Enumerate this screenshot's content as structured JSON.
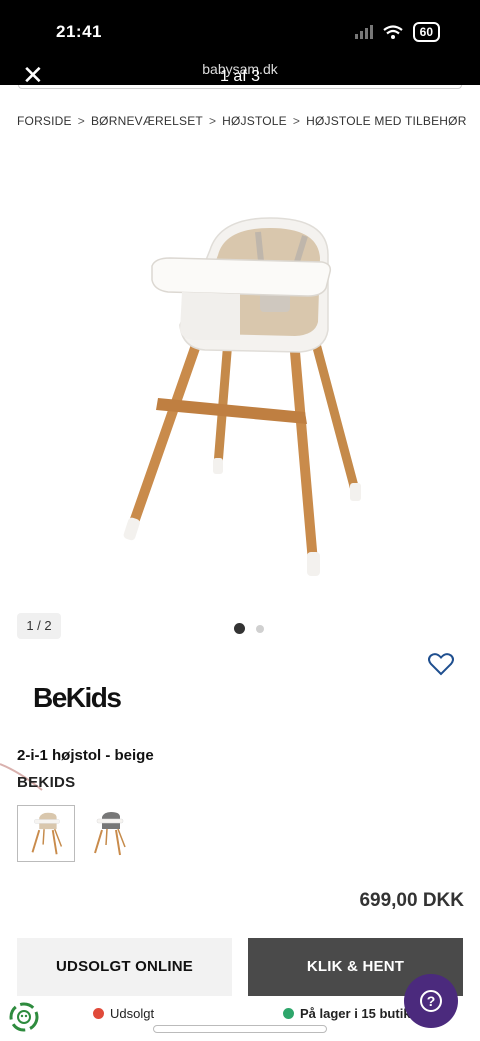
{
  "status_bar": {
    "time": "21:41",
    "battery": "60"
  },
  "browser": {
    "site": "babysam.dk",
    "counter": "1 af 3",
    "close_icon": "close-icon"
  },
  "breadcrumb": [
    {
      "label": "FORSIDE"
    },
    {
      "label": "BØRNEVÆRELSET"
    },
    {
      "label": "HØJSTOLE"
    },
    {
      "label": "HØJSTOLE MED TILBEHØR"
    }
  ],
  "breadcrumb_separator": ">",
  "gallery": {
    "counter": "1 / 2",
    "active_dot": 1,
    "dot_count": 2
  },
  "product": {
    "brand_logo": "BeKids",
    "title": "2-i-1 højstol - beige",
    "brand": "BEKIDS",
    "price": "699,00 DKK"
  },
  "actions": {
    "soldout_label": "UDSOLGT ONLINE",
    "click_collect_label": "KLIK & HENT"
  },
  "stock": {
    "online_label": "Udsolgt",
    "online_color": "#e04a3a",
    "store_label": "På lager i 15 butik",
    "store_color": "#2ea66b"
  },
  "colors": {
    "help_button": "#4b2a7d",
    "accent_heart": "#1f4f8f"
  }
}
